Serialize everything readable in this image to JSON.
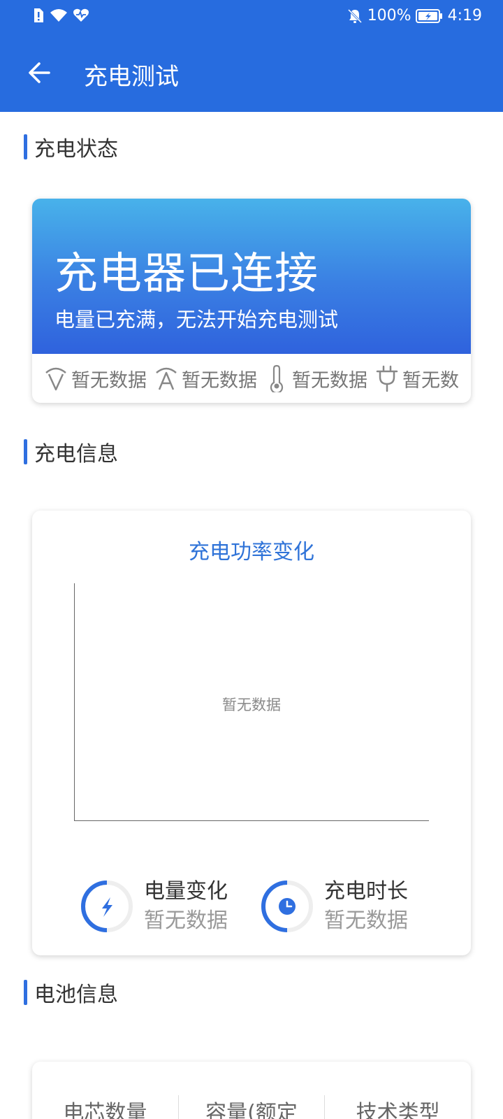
{
  "status_bar": {
    "battery_percent": "100%",
    "time": "4:19"
  },
  "app_bar": {
    "title": "充电测试"
  },
  "sections": {
    "charging_status": "充电状态",
    "charging_info": "充电信息",
    "battery_info": "电池信息"
  },
  "status_card": {
    "headline": "充电器已连接",
    "message": "电量已充满，无法开始充电测试",
    "stats": [
      {
        "icon": "voltage-icon",
        "value": "暂无数据"
      },
      {
        "icon": "current-icon",
        "value": "暂无数据"
      },
      {
        "icon": "thermometer-icon",
        "value": "暂无数据"
      },
      {
        "icon": "plug-icon",
        "value": "暂无数"
      }
    ]
  },
  "info_card": {
    "chart_title": "充电功率变化",
    "chart_empty": "暂无数据",
    "metrics": [
      {
        "icon": "lightning-icon",
        "name": "电量变化",
        "value": "暂无数据"
      },
      {
        "icon": "clock-icon",
        "name": "充电时长",
        "value": "暂无数据"
      }
    ]
  },
  "battery_card": {
    "columns": [
      "电芯数量",
      "容量(额定",
      "技术类型"
    ]
  },
  "colors": {
    "primary": "#276cdf",
    "accent_text": "#2f73d8",
    "hero_gradient_top": "#48b2ea",
    "hero_gradient_bottom": "#2f62dd"
  }
}
